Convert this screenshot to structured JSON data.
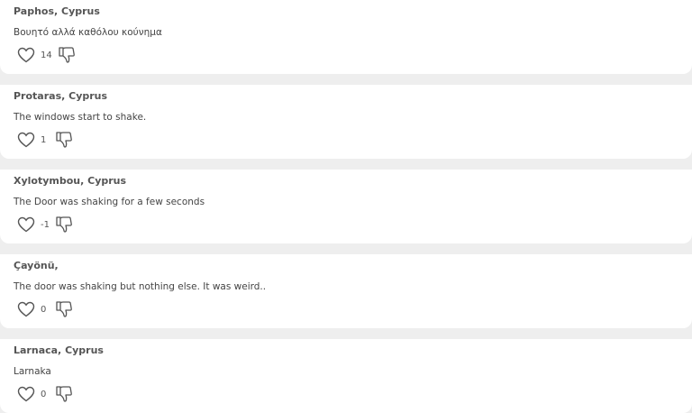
{
  "colors": {
    "background": "#eeeeee",
    "card": "#ffffff",
    "icon": "#555555"
  },
  "reports": [
    {
      "location": "Paphos, Cyprus",
      "message": "Βουητό αλλά καθόλου κούνημα",
      "likes": "14",
      "like_icon": "heart-outline-icon",
      "dislike_icon": "thumbs-down-outline-icon"
    },
    {
      "location": "Protaras, Cyprus",
      "message": "The windows start to shake.",
      "likes": "1",
      "like_icon": "heart-outline-icon",
      "dislike_icon": "thumbs-down-outline-icon"
    },
    {
      "location": "Xylotymbou, Cyprus",
      "message": "The Door was shaking for a few seconds",
      "likes": "-1",
      "like_icon": "heart-outline-icon",
      "dislike_icon": "thumbs-down-outline-icon"
    },
    {
      "location": "Çayönü,",
      "message": "The door was shaking but nothing else. It was weird..",
      "likes": "0",
      "like_icon": "heart-outline-icon",
      "dislike_icon": "thumbs-down-outline-icon"
    },
    {
      "location": "Larnaca, Cyprus",
      "message": "Larnaka",
      "likes": "0",
      "like_icon": "heart-outline-icon",
      "dislike_icon": "thumbs-down-outline-icon"
    }
  ]
}
